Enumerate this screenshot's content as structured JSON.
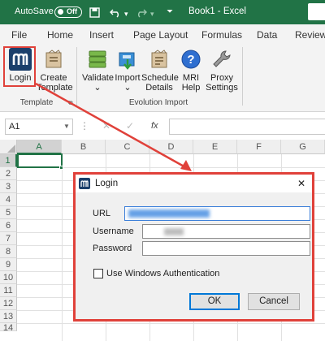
{
  "titlebar": {
    "autosave_label": "AutoSave",
    "autosave_state": "Off",
    "document_title": "Book1  -  Excel"
  },
  "menu": {
    "tabs": [
      "File",
      "Home",
      "Insert",
      "Page Layout",
      "Formulas",
      "Data",
      "Review"
    ]
  },
  "ribbon": {
    "template_group": {
      "label": "Template",
      "buttons": [
        {
          "label": "Login"
        },
        {
          "label": "Create",
          "label2": "Template"
        }
      ]
    },
    "evolution_group": {
      "label": "Evolution Import",
      "buttons": [
        {
          "label": "Validate",
          "dropdown": "⌄"
        },
        {
          "label": "Import",
          "dropdown": "⌄"
        },
        {
          "label": "Schedule",
          "label2": "Details"
        },
        {
          "label": "MRI",
          "label2": "Help"
        },
        {
          "label": "Proxy",
          "label2": "Settings"
        }
      ]
    }
  },
  "formula_bar": {
    "name_box": "A1",
    "fx_label": "fx"
  },
  "grid": {
    "columns": [
      "A",
      "B",
      "C",
      "D",
      "E",
      "F",
      "G"
    ],
    "rows": [
      "1",
      "2",
      "3",
      "4",
      "5",
      "6",
      "7",
      "8",
      "9",
      "10",
      "11",
      "12",
      "13",
      "14"
    ]
  },
  "dialog": {
    "title": "Login",
    "close_glyph": "✕",
    "url_label": "URL",
    "username_label": "Username",
    "password_label": "Password",
    "windows_auth_label": "Use Windows Authentication",
    "ok_label": "OK",
    "cancel_label": "Cancel"
  },
  "colors": {
    "excel_green": "#217346",
    "annotation_red": "#e0413a",
    "blurred_blue": "#4a90e2"
  }
}
